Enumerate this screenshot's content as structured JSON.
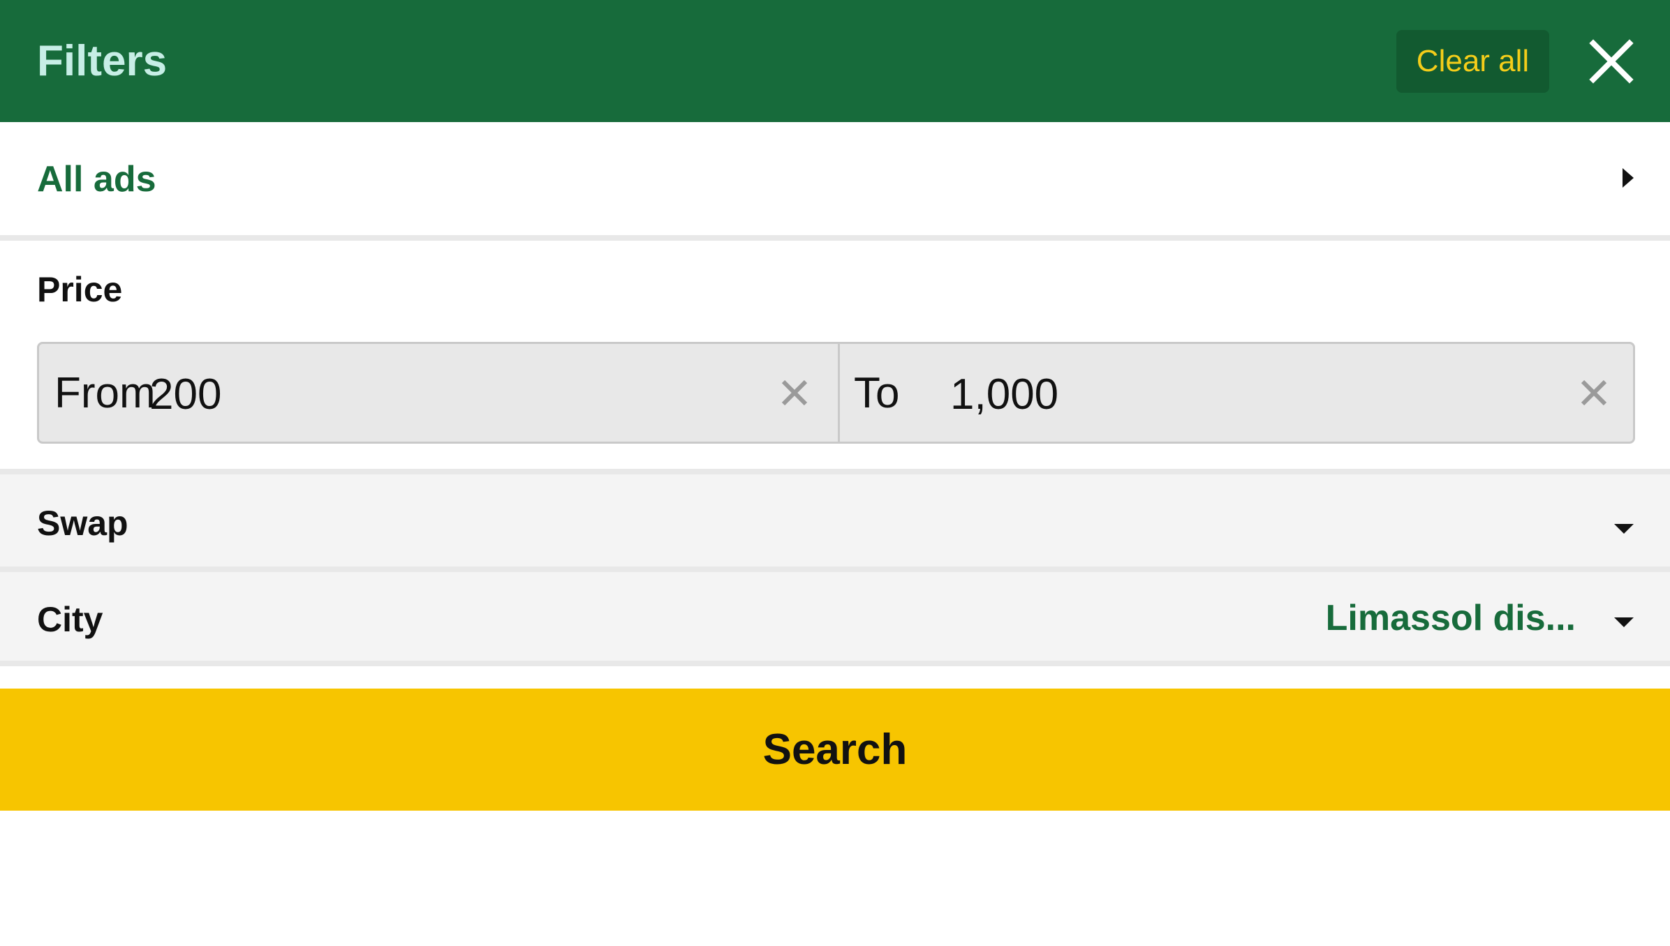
{
  "header": {
    "title": "Filters",
    "clear_all_label": "Clear all",
    "close_icon": "close-icon",
    "background_color": "#176b3b",
    "title_color": "#c7eee6",
    "clear_all_color": "#f4cd1a"
  },
  "category": {
    "label": "All ads",
    "icon": "chevron-right-icon"
  },
  "price": {
    "label": "Price",
    "from": {
      "prefix": "From",
      "value": "200"
    },
    "to": {
      "prefix": "To",
      "value": "1,000"
    },
    "clear_icon": "clear-x-icon"
  },
  "swap": {
    "label": "Swap",
    "icon": "caret-down-icon"
  },
  "city": {
    "label": "City",
    "selected": "Limassol dis...",
    "icon": "caret-down-icon"
  },
  "search": {
    "label": "Search",
    "color": "#f7c500"
  }
}
